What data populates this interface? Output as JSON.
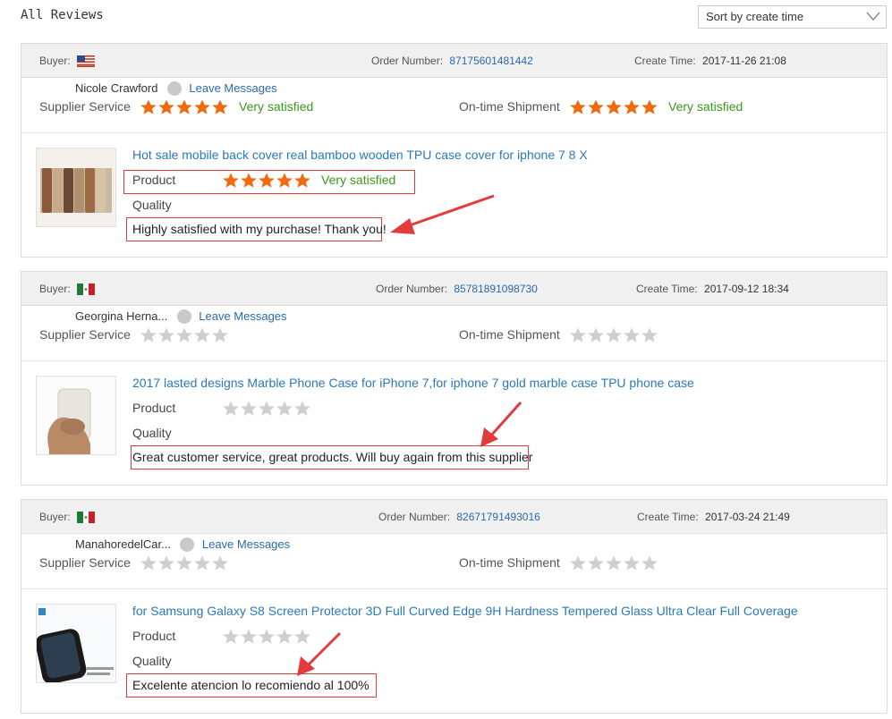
{
  "page": {
    "title": "All Reviews"
  },
  "sort": {
    "label": "Sort by create time"
  },
  "labels": {
    "buyer": "Buyer:",
    "order_number": "Order Number:",
    "create_time": "Create Time:",
    "supplier_service": "Supplier Service",
    "ontime_shipment": "On-time Shipment",
    "product": "Product",
    "quality": "Quality",
    "leave_messages": "Leave Messages"
  },
  "colors": {
    "star_on": "#f06a0f",
    "star_off": "#cfcfcf",
    "link": "#2a7ab8",
    "satisfied": "#3a9a1a",
    "highlight": "#e23b3b"
  },
  "reviews": [
    {
      "flag": "us-flag",
      "order_number": "87175601481442",
      "create_time": "2017-11-26 21:08",
      "buyer_name": "Nicole Crawford",
      "supplier_rating": 5,
      "supplier_text": "Very satisfied",
      "shipment_rating": 5,
      "shipment_text": "Very satisfied",
      "product_title": "Hot sale mobile back cover real bamboo wooden TPU case cover for iphone 7 8 X",
      "product_rating": 5,
      "product_text": "Very satisfied",
      "comment": "Highly satisfied with my purchase! Thank you!",
      "thumb_icon": "wooden-phone-cases-image"
    },
    {
      "flag": "mexico-flag",
      "order_number": "85781891098730",
      "create_time": "2017-09-12 18:34",
      "buyer_name": "Georgina Herna...",
      "supplier_rating": 0,
      "supplier_text": "",
      "shipment_rating": 0,
      "shipment_text": "",
      "product_title": "2017 lasted designs Marble Phone Case for iPhone 7,for iphone 7 gold marble case TPU phone case",
      "product_rating": 0,
      "product_text": "",
      "comment": "Great customer service, great products. Will buy again from this supplier",
      "thumb_icon": "hand-holding-case-image"
    },
    {
      "flag": "mexico-flag",
      "order_number": "82671791493016",
      "create_time": "2017-03-24 21:49",
      "buyer_name": "ManahoredelCar...",
      "supplier_rating": 0,
      "supplier_text": "",
      "shipment_rating": 0,
      "shipment_text": "",
      "product_title": "for Samsung Galaxy S8 Screen Protector 3D Full Curved Edge 9H Hardness Tempered Glass Ultra Clear Full Coverage",
      "product_rating": 0,
      "product_text": "",
      "comment": "Excelente atencion lo recomiendo al 100%",
      "thumb_icon": "screen-protector-image"
    }
  ]
}
